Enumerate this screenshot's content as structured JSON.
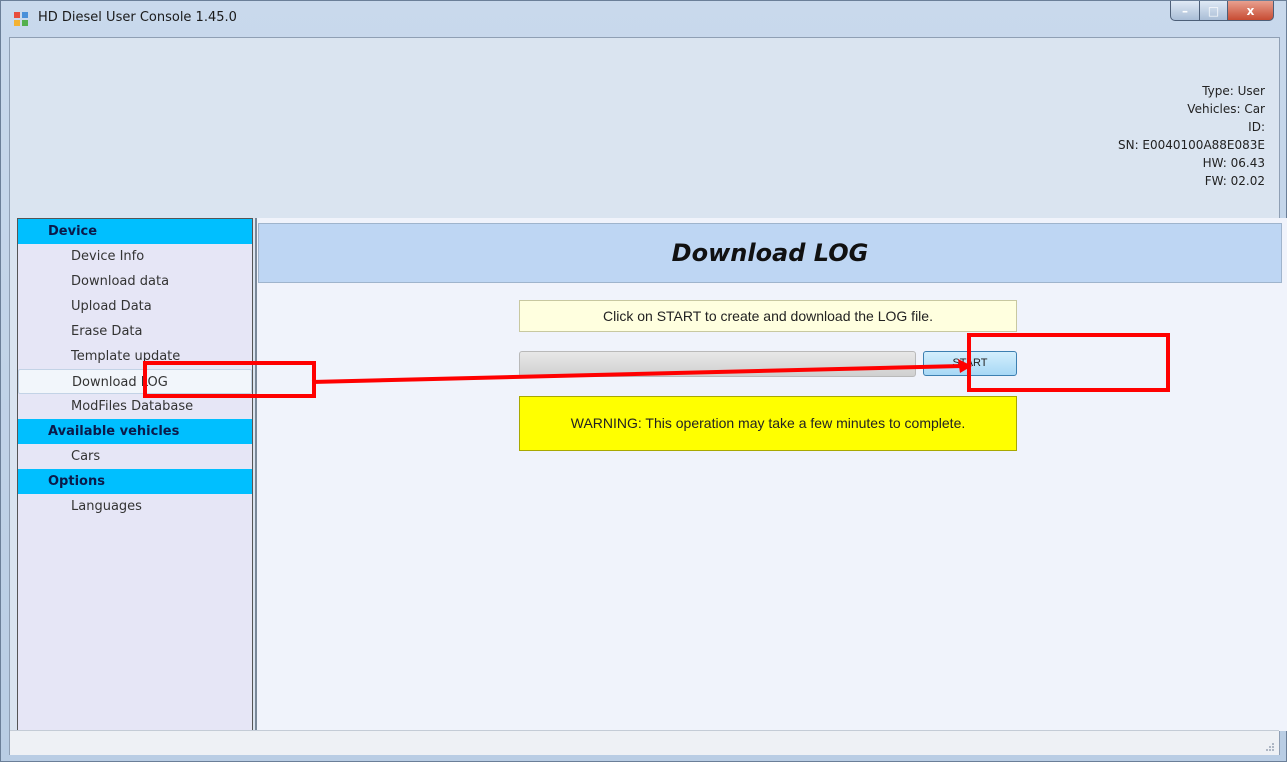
{
  "window": {
    "title": "HD Diesel User Console 1.45.0",
    "controls": {
      "minimize": "–",
      "maximize": "□",
      "close": "x"
    }
  },
  "device_info": {
    "type": "Type: User",
    "vehicles": "Vehicles: Car",
    "id": "ID:",
    "sn": "SN: E0040100A88E083E",
    "hw": "HW: 06.43",
    "fw": "FW: 02.02"
  },
  "sidebar": {
    "categories": [
      {
        "label": "Device",
        "items": [
          "Device Info",
          "Download data",
          "Upload Data",
          "Erase Data",
          "Template update",
          "Download LOG",
          "ModFiles Database"
        ]
      },
      {
        "label": "Available vehicles",
        "items": [
          "Cars"
        ]
      },
      {
        "label": "Options",
        "items": [
          "Languages"
        ]
      }
    ],
    "selected_item": "Download LOG"
  },
  "main": {
    "header_title": "Download LOG",
    "instruction": "Click on START to create and download the LOG file.",
    "progress": 0,
    "start_button": "START",
    "warning": "WARNING: This operation may take a few minutes to complete."
  },
  "colors": {
    "category_bg": "#00bfff",
    "warning_bg": "#ffff00",
    "annotation": "#ff0000",
    "header_bg": "#bed6f3"
  }
}
